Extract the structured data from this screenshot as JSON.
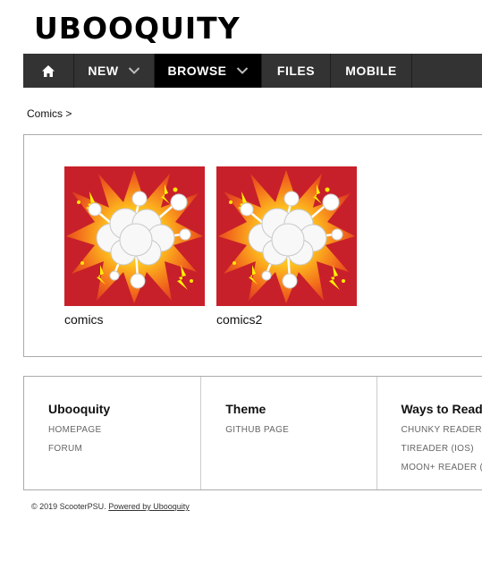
{
  "header": {
    "logo": "UBOOQUITY"
  },
  "nav": {
    "home_icon": "home-icon",
    "items": [
      {
        "label": "NEW",
        "dropdown": true
      },
      {
        "label": "BROWSE",
        "dropdown": true,
        "active": true
      },
      {
        "label": "FILES"
      },
      {
        "label": "MOBILE"
      }
    ]
  },
  "breadcrumb": "Comics >",
  "browse": {
    "items": [
      {
        "label": "comics",
        "thumbnail": "comic-explosion-thumbnail"
      },
      {
        "label": "comics2",
        "thumbnail": "comic-explosion-thumbnail"
      }
    ]
  },
  "footer": {
    "columns": [
      {
        "title": "Ubooquity",
        "links": [
          "HOMEPAGE",
          "FORUM"
        ]
      },
      {
        "title": "Theme",
        "links": [
          "GITHUB PAGE"
        ]
      },
      {
        "title": "Ways to Read",
        "links": [
          "CHUNKY READER",
          "TIREADER (IOS)",
          "MOON+ READER (A"
        ]
      }
    ],
    "copyright": "© 2019 ScooterPSU.",
    "powered_by": "Powered by Ubooquity"
  },
  "colors": {
    "nav_bg": "#333333",
    "nav_active": "#000000",
    "thumb_red": "#c8202a",
    "thumb_orange": "#f7941d"
  }
}
